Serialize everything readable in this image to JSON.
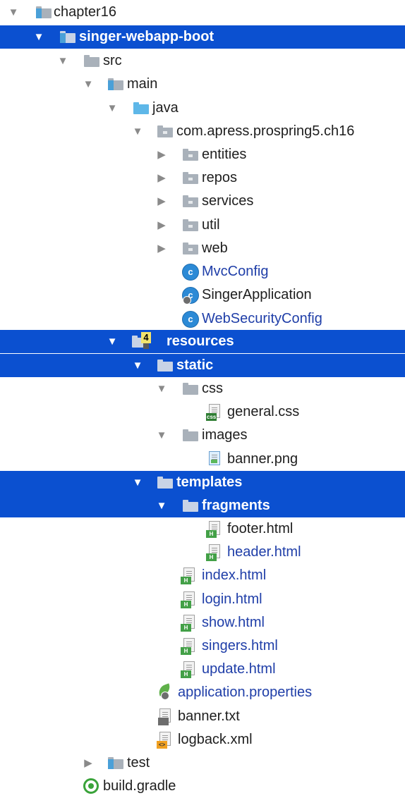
{
  "tree": {
    "nodes": [
      {
        "label": "chapter16",
        "arrow": "▼",
        "icon": "module-folder-icon",
        "blue": false
      },
      {
        "label": "singer-webapp-boot",
        "arrow": "▼",
        "icon": "module-folder-icon",
        "selected": true
      },
      {
        "label": "src",
        "arrow": "▼",
        "icon": "folder-icon"
      },
      {
        "label": "main",
        "arrow": "▼",
        "icon": "source-folder-icon"
      },
      {
        "label": "java",
        "arrow": "▼",
        "icon": "java-folder-icon"
      },
      {
        "label": "com.apress.prospring5.ch16",
        "arrow": "▼",
        "icon": "package-icon"
      },
      {
        "label": "entities",
        "arrow": "▶",
        "icon": "package-icon"
      },
      {
        "label": "repos",
        "arrow": "▶",
        "icon": "package-icon"
      },
      {
        "label": "services",
        "arrow": "▶",
        "icon": "package-icon"
      },
      {
        "label": "util",
        "arrow": "▶",
        "icon": "package-icon"
      },
      {
        "label": "web",
        "arrow": "▶",
        "icon": "package-icon"
      },
      {
        "label": "MvcConfig",
        "icon": "class-icon",
        "blue": true
      },
      {
        "label": "SingerApplication",
        "icon": "spring-boot-class-icon"
      },
      {
        "label": "WebSecurityConfig",
        "icon": "class-icon",
        "blue": true
      },
      {
        "label": "resources",
        "arrow": "▼",
        "icon": "resources-folder-icon",
        "selected": true,
        "badge": "4"
      },
      {
        "label": "static",
        "arrow": "▼",
        "icon": "folder-icon",
        "selected": true
      },
      {
        "label": "css",
        "arrow": "▼",
        "icon": "folder-icon"
      },
      {
        "label": "general.css",
        "icon": "css-file-icon"
      },
      {
        "label": "images",
        "arrow": "▼",
        "icon": "folder-icon"
      },
      {
        "label": "banner.png",
        "icon": "image-file-icon"
      },
      {
        "label": "templates",
        "arrow": "▼",
        "icon": "folder-icon",
        "selected": true
      },
      {
        "label": "fragments",
        "arrow": "▼",
        "icon": "folder-icon",
        "selected": true
      },
      {
        "label": "footer.html",
        "icon": "html-file-icon"
      },
      {
        "label": "header.html",
        "icon": "html-file-icon",
        "blue": true
      },
      {
        "label": "index.html",
        "icon": "html-file-icon",
        "blue": true
      },
      {
        "label": "login.html",
        "icon": "html-file-icon",
        "blue": true
      },
      {
        "label": "show.html",
        "icon": "html-file-icon",
        "blue": true
      },
      {
        "label": "singers.html",
        "icon": "html-file-icon",
        "blue": true
      },
      {
        "label": "update.html",
        "icon": "html-file-icon",
        "blue": true
      },
      {
        "label": "application.properties",
        "icon": "spring-properties-icon",
        "blue": true
      },
      {
        "label": "banner.txt",
        "icon": "text-file-icon"
      },
      {
        "label": "logback.xml",
        "icon": "xml-file-icon"
      },
      {
        "label": "test",
        "arrow": "▶",
        "icon": "test-folder-icon"
      },
      {
        "label": "build.gradle",
        "icon": "gradle-file-icon"
      }
    ]
  }
}
